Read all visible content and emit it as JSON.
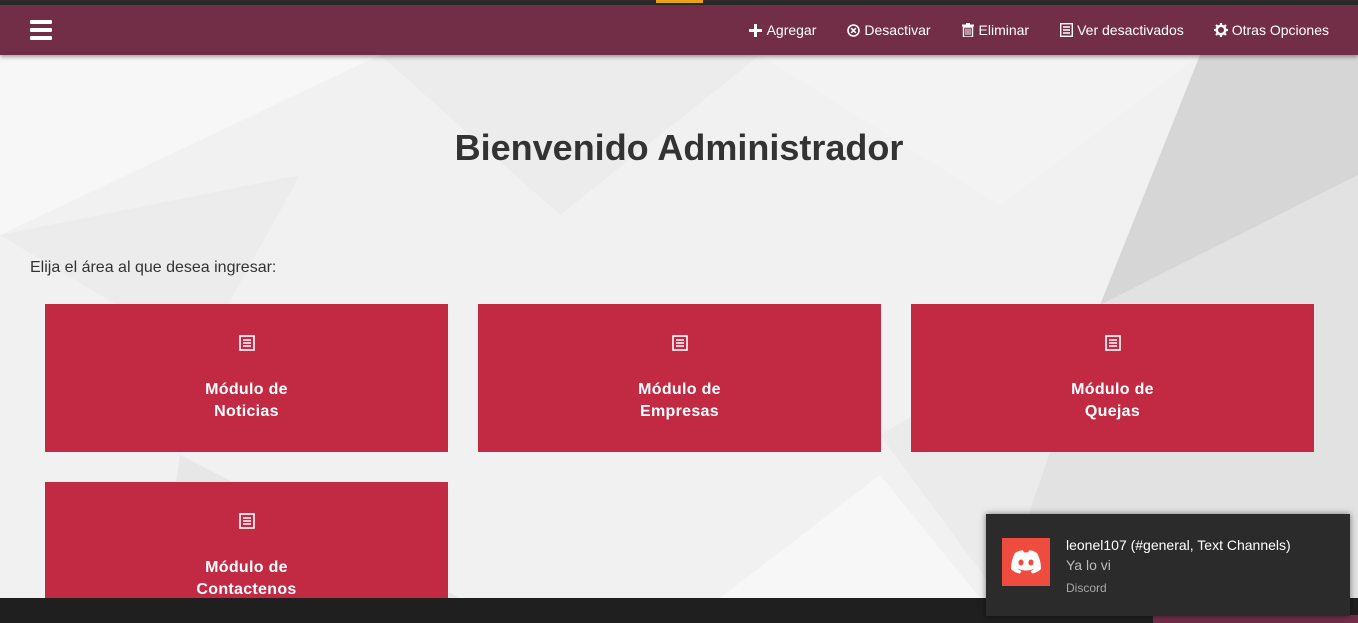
{
  "navbar": {
    "menu_icon": "hamburger-menu-icon",
    "links": [
      {
        "icon": "plus-icon",
        "label": "Agregar"
      },
      {
        "icon": "circle-x-icon",
        "label": "Desactivar"
      },
      {
        "icon": "trash-icon",
        "label": "Eliminar"
      },
      {
        "icon": "list-icon",
        "label": "Ver desactivados"
      },
      {
        "icon": "gear-icon",
        "label": "Otras Opciones"
      }
    ]
  },
  "main": {
    "title": "Bienvenido Administrador",
    "prompt": "Elija el área al que desea ingresar:",
    "modules": [
      {
        "icon": "list-icon",
        "line1": "Módulo de",
        "line2": "Noticias"
      },
      {
        "icon": "list-icon",
        "line1": "Módulo de",
        "line2": "Empresas"
      },
      {
        "icon": "list-icon",
        "line1": "Módulo de",
        "line2": "Quejas"
      },
      {
        "icon": "list-icon",
        "line1": "Módulo de",
        "line2": "Contactenos"
      }
    ]
  },
  "notification": {
    "app_icon": "discord-icon",
    "title": "leonel107 (#general, Text Channels)",
    "message": "Ya lo vi",
    "app": "Discord"
  },
  "colors": {
    "navbar": "#722e47",
    "card": "#c22a44",
    "accent": "#e8a317",
    "discord": "#ef4b3f"
  }
}
